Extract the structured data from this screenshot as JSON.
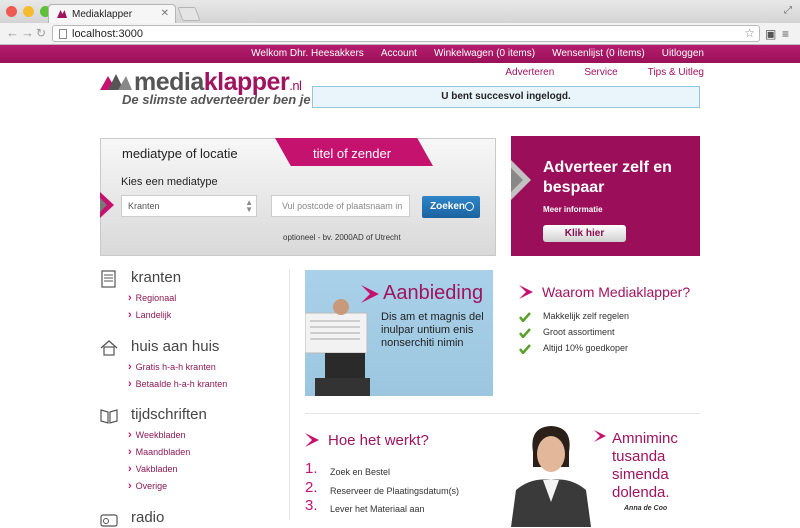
{
  "browser": {
    "tab_title": "Mediaklapper",
    "url": "localhost:3000"
  },
  "topbar": {
    "links": [
      "Welkom Dhr. Heesakkers",
      "Account",
      "Winkelwagen (0 items)",
      "Wensenlijst (0 items)",
      "Uitloggen"
    ]
  },
  "logo": {
    "part1": "media",
    "part2": "klapper",
    "part3": ".nl",
    "tagline": "De slimste adverteerder ben je zelf"
  },
  "secondary_nav": [
    "Adverteren",
    "Service",
    "Tips & Uitleg"
  ],
  "flash": "U bent succesvol ingelogd.",
  "search": {
    "tab_active": "mediatype of locatie",
    "tab_inactive": "titel of zender",
    "label": "Kies een mediatype",
    "select_value": "Kranten",
    "input_placeholder": "Vul postcode of plaatsnaam in",
    "button": "Zoeken",
    "hint": "optioneel - bv. 2000AD of Utrecht"
  },
  "ad": {
    "title": "Adverteer zelf en bespaar",
    "sub": "Meer informatie",
    "button": "Klik hier"
  },
  "categories": [
    {
      "title": "kranten",
      "links": [
        "Regionaal",
        "Landelijk"
      ]
    },
    {
      "title": "huis aan huis",
      "links": [
        "Gratis h-a-h kranten",
        "Betaalde h-a-h kranten"
      ]
    },
    {
      "title": "tijdschriften",
      "links": [
        "Weekbladen",
        "Maandbladen",
        "Vakbladen",
        "Overige"
      ]
    },
    {
      "title": "radio",
      "links": []
    }
  ],
  "promo": {
    "title": "Aanbieding",
    "text": "Dis am et magnis del inulpar untium enis nonserchiti nimin"
  },
  "why": {
    "title": "Waarom Mediaklapper?",
    "items": [
      "Makkelijk zelf regelen",
      "Groot assortiment",
      "Altijd 10% goedkoper"
    ]
  },
  "how": {
    "title": "Hoe het werkt?",
    "steps": [
      {
        "num": "1.",
        "text": "Zoek en Bestel"
      },
      {
        "num": "2.",
        "text": "Reserveer de Plaatingsdatum(s)"
      },
      {
        "num": "3.",
        "text": "Lever het Materiaal aan"
      }
    ]
  },
  "testimonial": {
    "quote": "Amniminc tusanda simenda dolenda.",
    "name": "Anna de Coo"
  },
  "colors": {
    "brand": "#a0135e",
    "accent": "#c6126f",
    "button_blue": "#1b63a0",
    "check_green": "#5aa02c"
  }
}
